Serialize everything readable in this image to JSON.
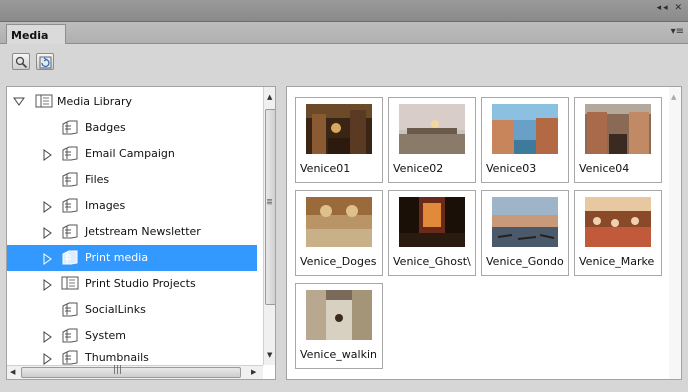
{
  "panel": {
    "tab_label": "Media",
    "title_controls": "◂◂ ✕",
    "menu_glyph": "▾≡"
  },
  "toolbar": {
    "buttons": [
      {
        "icon": "search-icon"
      },
      {
        "icon": "refresh-icon"
      }
    ]
  },
  "tree": {
    "root_label": "Media Library",
    "items": [
      {
        "label": "Badges",
        "expandable": false
      },
      {
        "label": "Email Campaign",
        "expandable": true
      },
      {
        "label": "Files",
        "expandable": false
      },
      {
        "label": "Images",
        "expandable": true
      },
      {
        "label": "Jetstream Newsletter",
        "expandable": true
      },
      {
        "label": "Print media",
        "expandable": true,
        "selected": true
      },
      {
        "label": "Print Studio Projects",
        "expandable": true
      },
      {
        "label": "SocialLinks",
        "expandable": false
      },
      {
        "label": "System",
        "expandable": true
      },
      {
        "label": "Thumbnails",
        "expandable": true
      }
    ],
    "selection_color": "#3399ff"
  },
  "grid": {
    "items": [
      {
        "label": "Venice01"
      },
      {
        "label": "Venice02"
      },
      {
        "label": "Venice03"
      },
      {
        "label": "Venice04"
      },
      {
        "label": "Venice_Doges"
      },
      {
        "label": "Venice_Ghost\\"
      },
      {
        "label": "Venice_Gondo"
      },
      {
        "label": "Venice_Marke"
      },
      {
        "label": "Venice_walkin"
      }
    ]
  }
}
